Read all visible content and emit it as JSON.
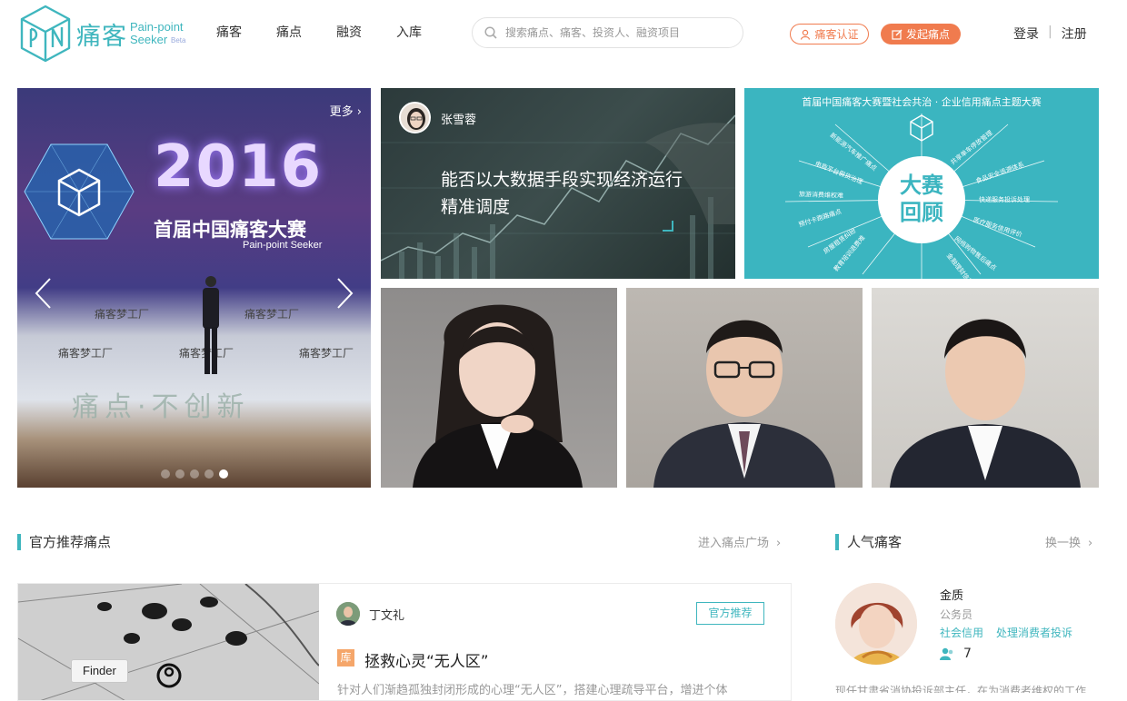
{
  "brand": {
    "name_cn": "痛客",
    "name_en_line1": "Pain-point",
    "name_en_line2": "Seeker",
    "beta": "Beta",
    "color": "#3fb6be"
  },
  "nav": [
    "痛客",
    "痛点",
    "融资",
    "入库"
  ],
  "search": {
    "placeholder": "搜索痛点、痛客、投资人、融资项目"
  },
  "actions": {
    "certify": "痛客认证",
    "launch": "发起痛点",
    "accent": "#f07b4e"
  },
  "auth": {
    "login": "登录",
    "separator": "|",
    "register": "注册"
  },
  "carousel": {
    "more": "更多",
    "year": "2016",
    "title": "首届中国痛客大赛",
    "subtitle": "Pain-point Seeker",
    "wall_text": "痛客梦工厂",
    "banner_text": "痛点·不创新",
    "active_slide": 5,
    "slide_count": 5
  },
  "article_card": {
    "author": "张雪蓉",
    "title": "能否以大数据手段实现经济运行精准调度"
  },
  "review_card": {
    "heading": "首届中国痛客大赛暨社会共治 · 企业信用痛点主题大赛",
    "center_line1": "大赛",
    "center_line2": "回顾",
    "rays": [
      "新能源汽车推广痛点",
      "共享单车停放管理",
      "电商平台假货治理",
      "食品安全追溯体系",
      "旅游消费维权难",
      "快递服务投诉处理",
      "预付卡跑路痛点",
      "医疗服务信用评价",
      "房屋租赁纠纷",
      "网络购物售后痛点",
      "教育培训退费难",
      "金融理财信用风险"
    ]
  },
  "sections": {
    "official": {
      "title": "官方推荐痛点",
      "link": "进入痛点广场"
    },
    "popular": {
      "title": "人气痛客",
      "link": "换一换"
    }
  },
  "feature": {
    "author": "丁文礼",
    "badge": "官方推荐",
    "tag": "库",
    "title": "拯救心灵“无人区”",
    "description": "针对人们渐趋孤独封闭形成的心理“无人区”，搭建心理疏导平台，增进个体",
    "tooltip": "Finder"
  },
  "popular_user": {
    "name": "金质",
    "role": "公务员",
    "tags": [
      "社会信用",
      "处理消费者投诉"
    ],
    "count": "7",
    "description": "现任甘肃省消协投诉部主任，在为消费者维权的工作"
  }
}
